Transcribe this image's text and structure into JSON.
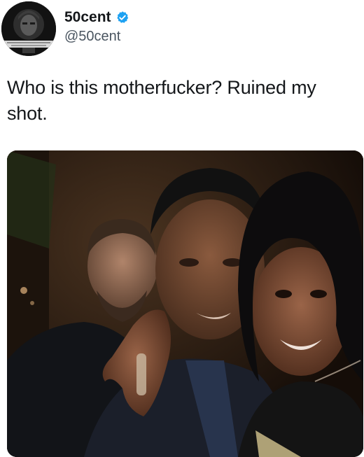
{
  "tweet": {
    "author": {
      "display_name": "50cent",
      "handle": "@50cent",
      "verified": true,
      "verified_icon": "verified-badge-icon",
      "verified_color": "#1da1f2"
    },
    "text": "Who is this motherfucker? Ruined my shot.",
    "media": {
      "type": "photo",
      "icon": "photo"
    }
  }
}
